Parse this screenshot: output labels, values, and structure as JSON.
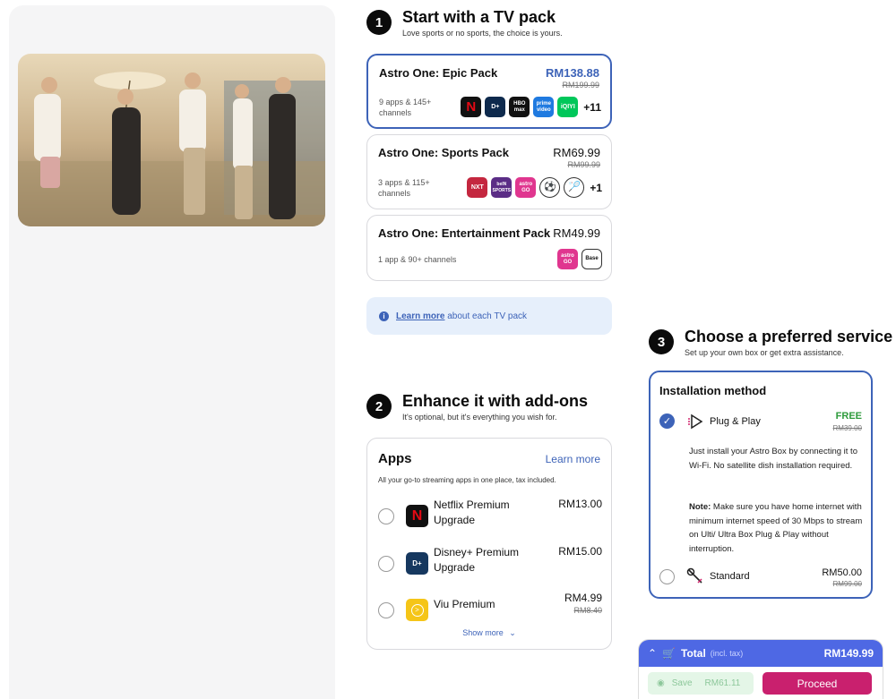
{
  "step1": {
    "number": "1",
    "title": "Start with a TV pack",
    "subtitle": "Love sports or no sports, the choice is yours."
  },
  "packs": [
    {
      "name": "Astro One: Epic Pack",
      "price": "RM138.88",
      "old_price": "RM199.99",
      "desc": "9 apps & 145+ channels",
      "more": "+11",
      "selected": true,
      "apps": [
        {
          "label": "N",
          "icon": "netflix-icon"
        },
        {
          "label": "D+",
          "icon": "disney-icon"
        },
        {
          "label": "HBO max",
          "icon": "hbo-max-icon"
        },
        {
          "label": "prime video",
          "icon": "prime-video-icon"
        },
        {
          "label": "iQIYI",
          "icon": "iqiyi-icon"
        }
      ]
    },
    {
      "name": "Astro One: Sports Pack",
      "price": "RM69.99",
      "old_price": "RM99.99",
      "desc": "3 apps & 115+ channels",
      "more": "+1",
      "selected": false,
      "apps": [
        {
          "label": "NXT",
          "icon": "sooka-nxt-icon"
        },
        {
          "label": "beIN SPORTS",
          "icon": "bein-sports-icon"
        },
        {
          "label": "astro GO",
          "icon": "astro-go-icon"
        },
        {
          "label": "⚽",
          "icon": "football-icon"
        },
        {
          "label": "🏸",
          "icon": "badminton-icon"
        }
      ]
    },
    {
      "name": "Astro One: Entertainment Pack",
      "price": "RM49.99",
      "old_price": "",
      "desc": "1 app & 90+ channels",
      "more": "",
      "selected": false,
      "apps": [
        {
          "label": "astro GO",
          "icon": "astro-go-icon"
        },
        {
          "label": "Base",
          "icon": "tv-base-icon"
        }
      ]
    }
  ],
  "info": {
    "link": "Learn more",
    "text": "about each TV pack"
  },
  "step2": {
    "number": "2",
    "title": "Enhance it with add-ons",
    "subtitle": "It's optional, but it's everything you wish for."
  },
  "apps_card": {
    "title": "Apps",
    "learn_more": "Learn more",
    "subtitle": "All your go-to streaming apps in one place, tax included.",
    "items": [
      {
        "name": "Netflix Premium Upgrade",
        "price": "RM13.00",
        "old_price": "",
        "icon": "netflix-icon"
      },
      {
        "name": "Disney+ Premium Upgrade",
        "price": "RM15.00",
        "old_price": "",
        "icon": "disney-icon"
      },
      {
        "name": "Viu Premium",
        "price": "RM4.99",
        "old_price": "RM8.40",
        "icon": "viu-icon"
      }
    ],
    "show_more": "Show more"
  },
  "step3": {
    "number": "3",
    "title": "Choose a preferred service",
    "subtitle": "Set up your own box or get extra assistance."
  },
  "installation": {
    "title": "Installation method",
    "option1": {
      "name": "Plug & Play",
      "price": "FREE",
      "old_price": "RM39.00",
      "selected": true
    },
    "desc1": "Just install your Astro Box by connecting it to Wi-Fi. No satellite dish installation required.",
    "note_label": "Note:",
    "note_text": " Make sure you have home internet with minimum internet speed of 30 Mbps to stream on Ulti/ Ultra Box Plug & Play without interruption.",
    "option2": {
      "name": "Standard",
      "price": "RM50.00",
      "old_price": "RM99.00",
      "selected": false
    }
  },
  "total": {
    "label": "Total",
    "incl": "(incl. tax)",
    "amount": "RM149.99",
    "save_label": "Save",
    "save_amount": "RM61.11",
    "proceed": "Proceed"
  },
  "colors": {
    "accent": "#3d63b8",
    "total_bar": "#4e68e4",
    "proceed": "#c9206e",
    "free": "#2e9b3c"
  }
}
